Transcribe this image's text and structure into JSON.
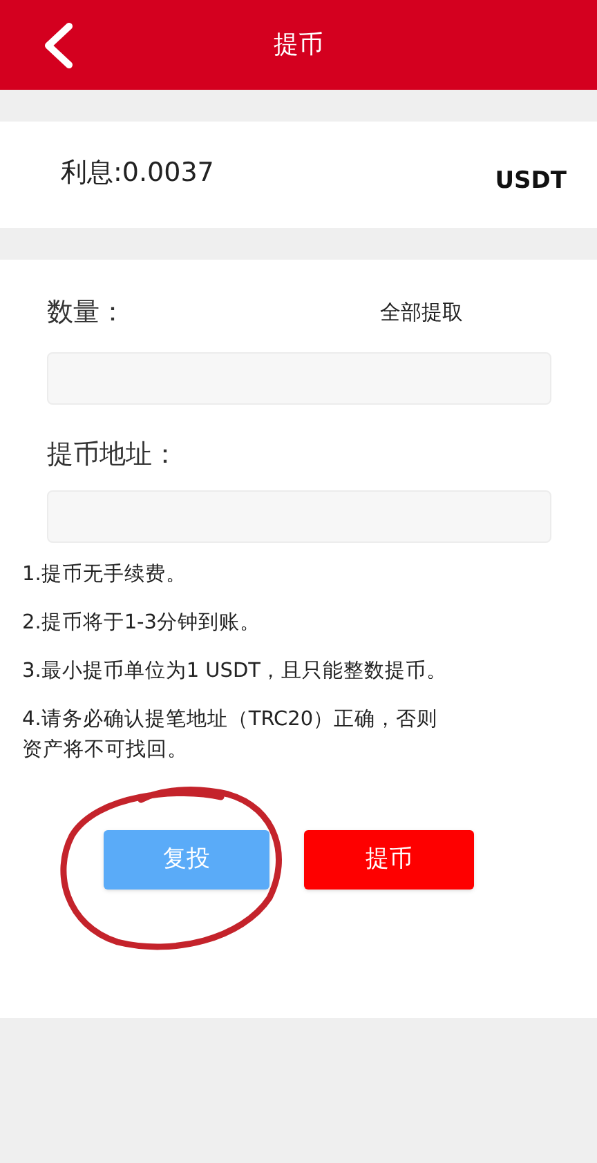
{
  "header": {
    "title": "提币"
  },
  "balance": {
    "label": "利息:0.0037",
    "currency": "USDT"
  },
  "form": {
    "amount_label": "数量：",
    "withdraw_all": "全部提取",
    "address_label": "提币地址："
  },
  "notes": [
    "1.提币无手续费。",
    "2.提币将于1-3分钟到账。",
    "3.最小提币单位为1 USDT，且只能整数提币。",
    "4.请务必确认提笔地址（TRC20）正确，否则资产将不可找回。"
  ],
  "buttons": [
    {
      "label": "复投",
      "kind": "secondary"
    },
    {
      "label": "提币",
      "kind": "primary"
    }
  ],
  "annotation": {
    "kind": "circle"
  }
}
